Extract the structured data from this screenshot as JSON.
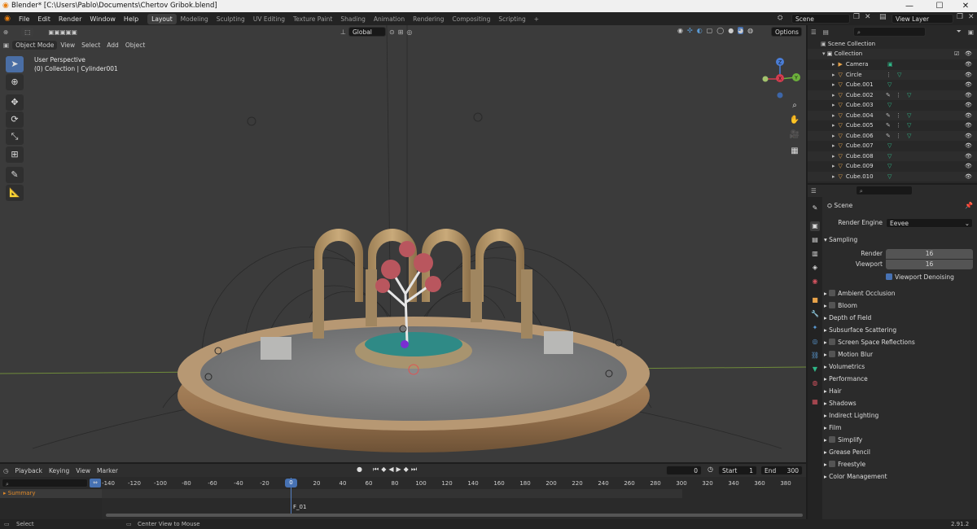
{
  "window": {
    "title": "Blender* [C:\\Users\\Pablo\\Documents\\Chertov Gribok.blend]",
    "minimize": "—",
    "maximize": "☐",
    "close": "✕"
  },
  "menu": [
    "File",
    "Edit",
    "Render",
    "Window",
    "Help"
  ],
  "workspaces": [
    "Layout",
    "Modeling",
    "Sculpting",
    "UV Editing",
    "Texture Paint",
    "Shading",
    "Animation",
    "Rendering",
    "Compositing",
    "Scripting"
  ],
  "add_workspace": "+",
  "scene_field": "Scene",
  "view_layer_field": "View Layer",
  "viewport": {
    "mode": "Object Mode",
    "menus": [
      "View",
      "Select",
      "Add",
      "Object"
    ],
    "transform": "Global",
    "options": "Options",
    "overlay_title": "User Perspective",
    "overlay_subtitle": "(0) Collection | Cylinder001",
    "axis_z": "Z",
    "axis_y": "Y",
    "axis_x": "X"
  },
  "outliner": {
    "root": "Scene Collection",
    "collection": "Collection",
    "items": [
      "Camera",
      "Circle",
      "Cube.001",
      "Cube.002",
      "Cube.003",
      "Cube.004",
      "Cube.005",
      "Cube.006",
      "Cube.007",
      "Cube.008",
      "Cube.009",
      "Cube.010"
    ]
  },
  "properties": {
    "context": "Scene",
    "render_engine_label": "Render Engine",
    "render_engine": "Eevee",
    "sampling": "Sampling",
    "render_label": "Render",
    "render_value": "16",
    "viewport_label": "Viewport",
    "viewport_value": "16",
    "viewport_denoising": "Viewport Denoising",
    "sections": [
      {
        "label": "Ambient Occlusion",
        "check": true
      },
      {
        "label": "Bloom",
        "check": true
      },
      {
        "label": "Depth of Field",
        "check": false
      },
      {
        "label": "Subsurface Scattering",
        "check": false
      },
      {
        "label": "Screen Space Reflections",
        "check": true
      },
      {
        "label": "Motion Blur",
        "check": true
      },
      {
        "label": "Volumetrics",
        "check": false
      },
      {
        "label": "Performance",
        "check": false
      },
      {
        "label": "Hair",
        "check": false
      },
      {
        "label": "Shadows",
        "check": false
      },
      {
        "label": "Indirect Lighting",
        "check": false
      },
      {
        "label": "Film",
        "check": false
      },
      {
        "label": "Simplify",
        "check": true
      },
      {
        "label": "Grease Pencil",
        "check": false
      },
      {
        "label": "Freestyle",
        "check": true
      },
      {
        "label": "Color Management",
        "check": false
      }
    ]
  },
  "timeline": {
    "menus": [
      "Playback",
      "Keying",
      "View",
      "Marker"
    ],
    "current_frame": "0",
    "start_label": "Start",
    "start": "1",
    "end_label": "End",
    "end": "300",
    "ticks": [
      "-140",
      "-120",
      "-100",
      "-80",
      "-60",
      "-40",
      "-20",
      "0",
      "20",
      "40",
      "60",
      "80",
      "100",
      "120",
      "140",
      "160",
      "180",
      "200",
      "220",
      "240",
      "260",
      "280",
      "300",
      "320",
      "340",
      "360",
      "380"
    ],
    "summary": "Summary",
    "marker": "F_01"
  },
  "status": {
    "select": "Select",
    "center": "Center View to Mouse",
    "version": "2.91.2"
  },
  "colors": {
    "accent": "#4772b3",
    "frame": "#5680c2",
    "summary": "#e08a2a"
  }
}
